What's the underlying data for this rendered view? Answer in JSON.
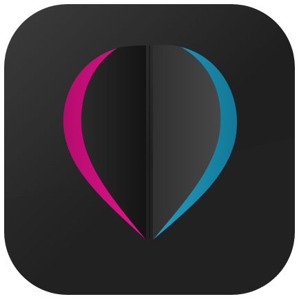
{
  "icon": {
    "name": "heart-pin-app-icon",
    "colors": {
      "tile_dark": "#1f1f1f",
      "tile_light": "#3c3c3c",
      "tile_shadow": "#262626",
      "panel_left": "#141414",
      "panel_left_edge": "#2a2a2a",
      "panel_right": "#303030",
      "panel_right_light": "#474747",
      "magenta": "#e8128c",
      "magenta_dark": "#b50c6e",
      "cyan": "#1f9fc4",
      "cyan_dark": "#137896"
    }
  }
}
